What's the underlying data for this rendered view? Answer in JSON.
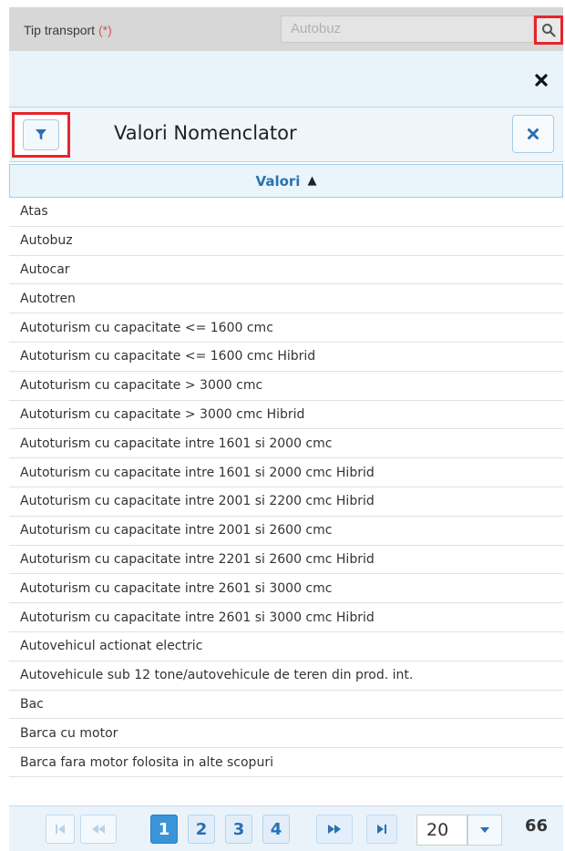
{
  "field": {
    "label": "Tip transport",
    "required_mark": "(*)",
    "value": "Autobuz",
    "search_icon": "search-icon"
  },
  "dialog": {
    "close_icon": "close-icon"
  },
  "panel": {
    "title": "Valori Nomenclator",
    "filter_icon": "filter-icon",
    "close_icon": "close-icon"
  },
  "table": {
    "column_header": "Valori",
    "sort_icon": "sort-icon",
    "rows": [
      "Atas",
      "Autobuz",
      "Autocar",
      "Autotren",
      "Autoturism cu capacitate <= 1600 cmc",
      "Autoturism cu capacitate <= 1600 cmc Hibrid",
      "Autoturism cu capacitate > 3000 cmc",
      "Autoturism cu capacitate > 3000 cmc Hibrid",
      "Autoturism cu capacitate intre 1601 si 2000 cmc",
      "Autoturism cu capacitate intre 1601 si 2000 cmc Hibrid",
      "Autoturism cu capacitate intre 2001 si 2200 cmc Hibrid",
      "Autoturism cu capacitate intre 2001 si 2600 cmc",
      "Autoturism cu capacitate intre 2201 si 2600 cmc Hibrid",
      "Autoturism cu capacitate intre 2601 si 3000 cmc",
      "Autoturism cu capacitate intre 2601 si 3000 cmc Hibrid",
      "Autovehicul actionat electric",
      "Autovehicule sub 12 tone/autovehicule de teren din prod. int.",
      "Bac",
      "Barca cu motor",
      "Barca fara motor folosita in alte scopuri"
    ]
  },
  "pager": {
    "pages": [
      "1",
      "2",
      "3",
      "4"
    ],
    "current_page": "1",
    "page_size": "20",
    "total_visible": "66",
    "colors": {
      "active": "#3a95d8",
      "accent": "#2a6fb3",
      "required": "#d9534f",
      "highlight": "#e6252b"
    }
  }
}
